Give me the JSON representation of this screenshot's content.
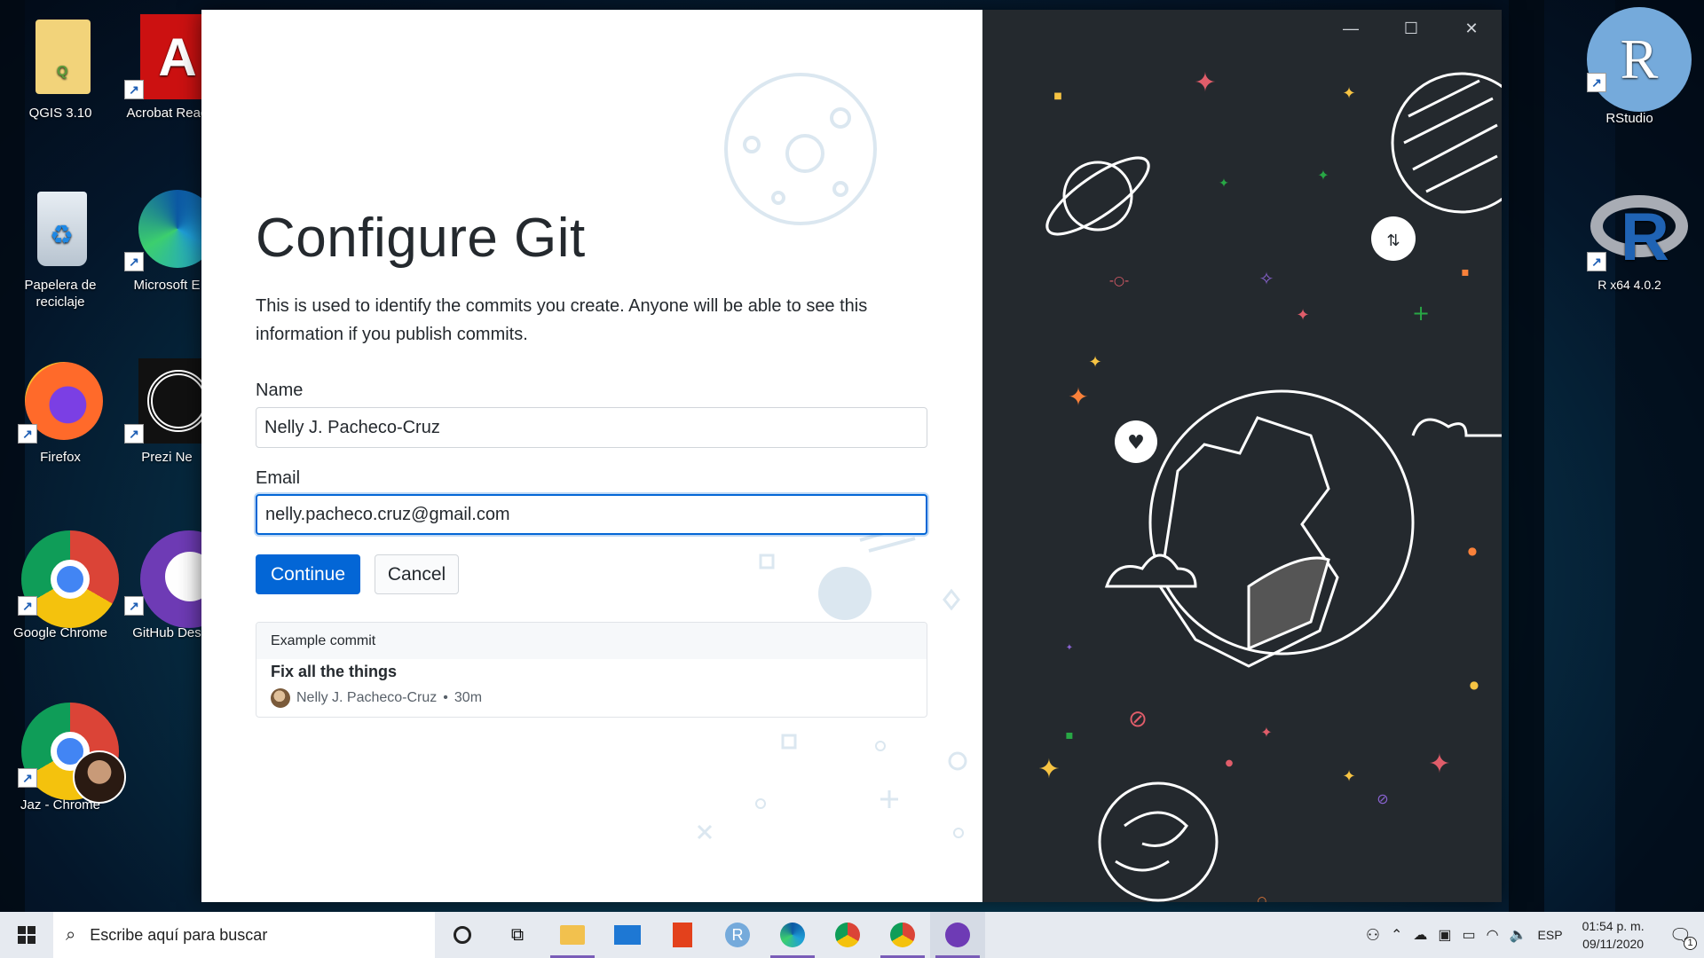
{
  "desktop": {
    "icons": [
      {
        "label": "QGIS 3.10"
      },
      {
        "label": "Acrobat Reac"
      },
      {
        "label": "Papelera de reciclaje"
      },
      {
        "label": "Microsoft E"
      },
      {
        "label": "Firefox"
      },
      {
        "label": "Prezi Ne"
      },
      {
        "label": "Google Chrome"
      },
      {
        "label": "GitHub Des"
      },
      {
        "label": "Jaz - Chrome"
      },
      {
        "label": "RStudio"
      },
      {
        "label": "R x64 4.0.2"
      }
    ]
  },
  "dialog": {
    "title": "Configure Git",
    "description": "This is used to identify the commits you create. Anyone will be able to see this information if you publish commits.",
    "name_label": "Name",
    "name_value": "Nelly J. Pacheco-Cruz",
    "email_label": "Email",
    "email_value": "nelly.pacheco.cruz@gmail.com",
    "continue_label": "Continue",
    "cancel_label": "Cancel",
    "example": {
      "header": "Example commit",
      "summary": "Fix all the things",
      "author": "Nelly J. Pacheco-Cruz",
      "separator": "•",
      "time": "30m"
    }
  },
  "window_controls": {
    "minimize": "—",
    "maximize": "☐",
    "close": "✕"
  },
  "taskbar": {
    "search_placeholder": "Escribe aquí para buscar",
    "language": "ESP",
    "time": "01:54 p. m.",
    "date": "09/11/2020",
    "notification_count": "1",
    "apps": [
      "cortana",
      "task-view",
      "file-explorer",
      "mail",
      "office",
      "rstudio",
      "edge",
      "chrome",
      "chrome-profile",
      "github-desktop"
    ]
  },
  "colors": {
    "primary": "#0366d6",
    "illustration_bg": "#24292e",
    "desktop_bg": "#083b52"
  }
}
